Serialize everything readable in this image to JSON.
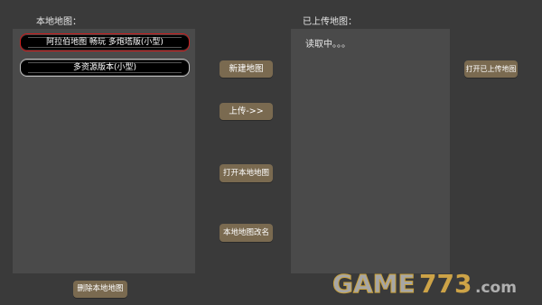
{
  "local_maps": {
    "title": "本地地图：",
    "items": [
      {
        "label": "阿拉伯地图 畅玩 多炮塔版(小型)",
        "selected": true
      },
      {
        "label": "多资源版本(小型)",
        "selected": false
      }
    ],
    "delete_button": "删除本地地图"
  },
  "actions": {
    "new_map": "新建地图",
    "upload": "上传->>",
    "open_local": "打开本地地图",
    "rename_local": "本地地图改名"
  },
  "uploaded_maps": {
    "title": "已上传地图：",
    "loading_text": "读取中。。。",
    "open_button": "打开已上传地图"
  },
  "watermark": {
    "text_game": "GAME",
    "text_num": "773",
    "text_suffix": ".com"
  },
  "colors": {
    "background": "#3a3a3a",
    "panel": "#4a4a4a",
    "button": "#7a6a50",
    "selected_border": "#d01c1c"
  }
}
